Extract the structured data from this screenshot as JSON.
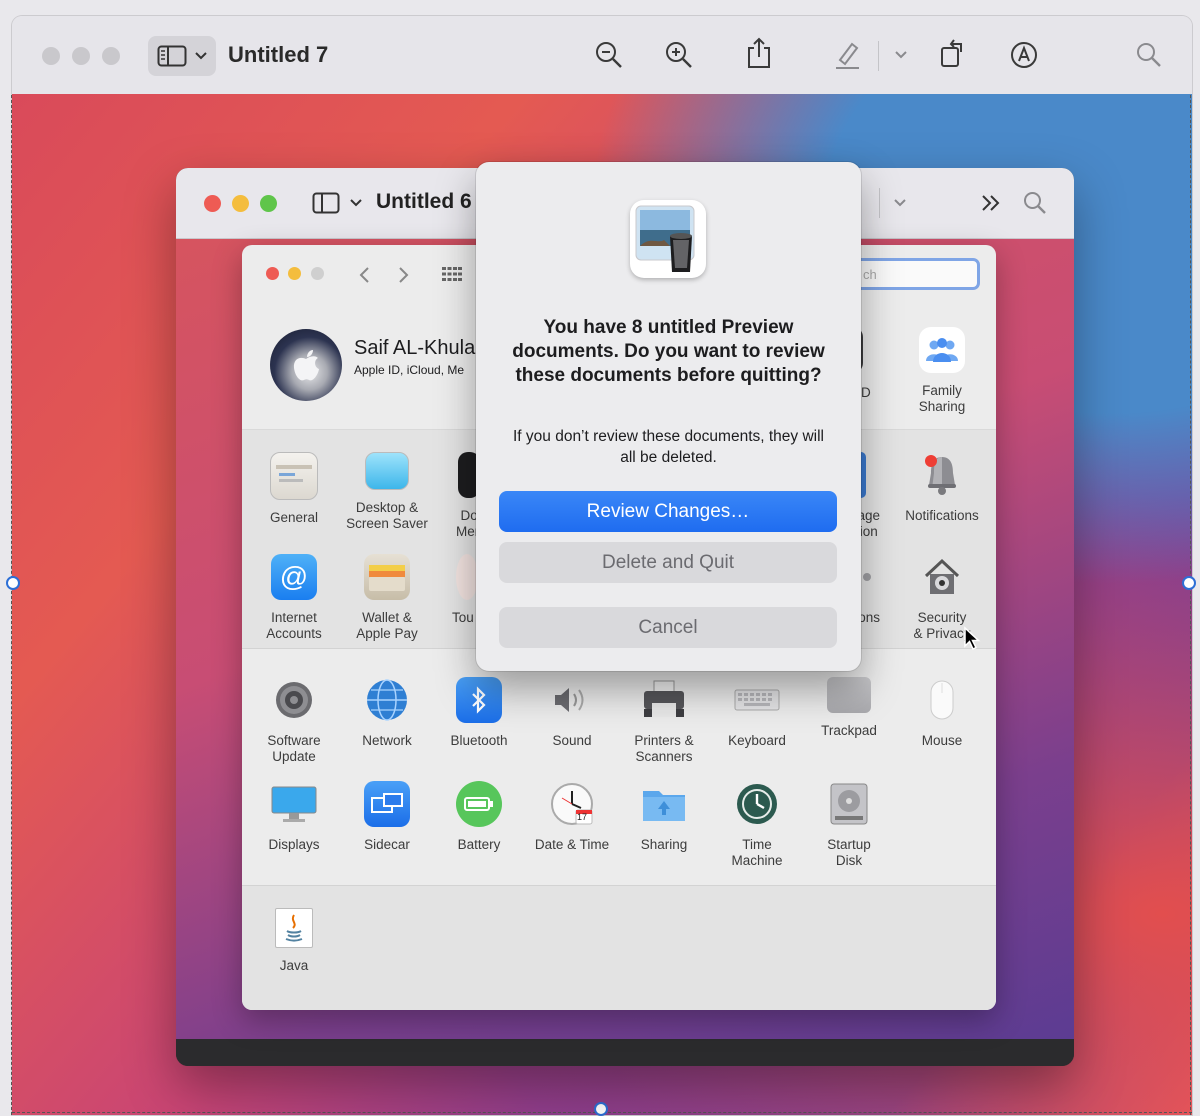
{
  "outer_window": {
    "title": "Untitled 7",
    "toolbar_icons": [
      "sidebar-icon",
      "zoom-out-icon",
      "zoom-in-icon",
      "share-icon",
      "highlight-pen-icon",
      "rotate-icon",
      "markup-icon",
      "search-icon"
    ]
  },
  "inner_window": {
    "title": "Untitled 6"
  },
  "sysprefs": {
    "search_placeholder": "ch",
    "account": {
      "name": "Saif AL-Khula",
      "subtitle": "Apple ID, iCloud, Me"
    },
    "top_right": [
      {
        "label": "ID"
      },
      {
        "label": "Family\nSharing"
      }
    ],
    "row1": [
      {
        "label": "General"
      },
      {
        "label": "Desktop &\nScreen Saver"
      },
      {
        "label": "Do\nMen"
      },
      {
        "label": "age\nion"
      },
      {
        "label": "Notifications"
      }
    ],
    "row2": [
      {
        "label": "Internet\nAccounts"
      },
      {
        "label": "Wallet &\nApple Pay"
      },
      {
        "label": "Tou"
      },
      {
        "label": "ons"
      },
      {
        "label": "Security\n& Privacy"
      }
    ],
    "row3": [
      {
        "label": "Software\nUpdate"
      },
      {
        "label": "Network"
      },
      {
        "label": "Bluetooth"
      },
      {
        "label": "Sound"
      },
      {
        "label": "Printers &\nScanners"
      },
      {
        "label": "Keyboard"
      },
      {
        "label": "Trackpad"
      },
      {
        "label": "Mouse"
      }
    ],
    "row4": [
      {
        "label": "Displays"
      },
      {
        "label": "Sidecar"
      },
      {
        "label": "Battery"
      },
      {
        "label": "Date & Time"
      },
      {
        "label": "Sharing"
      },
      {
        "label": "Time\nMachine"
      },
      {
        "label": "Startup\nDisk"
      }
    ],
    "row5": [
      {
        "label": "Java"
      }
    ],
    "date_badge": "17"
  },
  "dialog": {
    "title": "You have 8 untitled Preview documents. Do you want to review these documents before quitting?",
    "message": "If you don’t review these documents, they will all be deleted.",
    "review_label": "Review Changes…",
    "delete_label": "Delete and Quit",
    "cancel_label": "Cancel"
  },
  "colors": {
    "accent": "#1f6cf0",
    "close": "#ee5b54",
    "minimize": "#f4bd3d",
    "zoom": "#5fc54a"
  }
}
